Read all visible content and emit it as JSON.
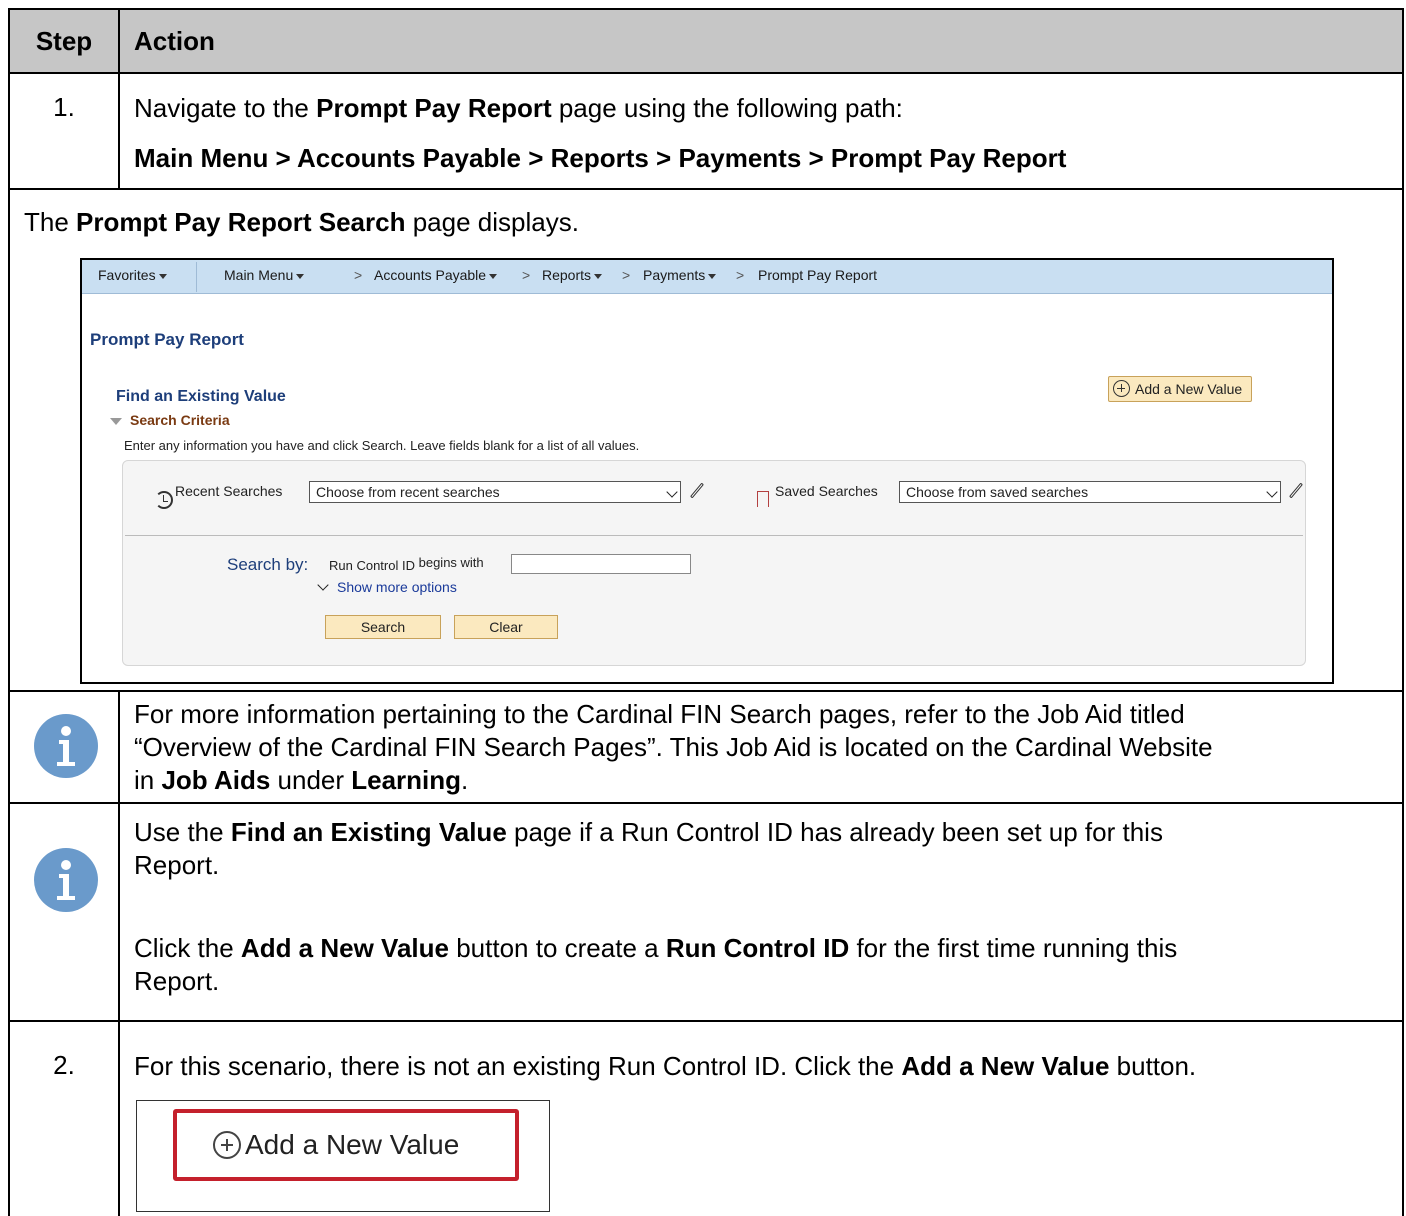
{
  "header": {
    "step": "Step",
    "action": "Action"
  },
  "step1": {
    "num": "1.",
    "line1_pre": "Navigate to the ",
    "line1_bold": "Prompt Pay Report",
    "line1_post": " page using the following path:",
    "path": "Main Menu > Accounts Payable > Reports > Payments > Prompt Pay Report"
  },
  "display": {
    "pre": "The ",
    "bold": "Prompt Pay Report Search",
    "post": " page displays."
  },
  "shot": {
    "nav": {
      "favorites": "Favorites",
      "main_menu": "Main Menu",
      "accounts_payable": "Accounts Payable",
      "reports": "Reports",
      "payments": "Payments",
      "prompt_pay": "Prompt Pay Report",
      "sep": ">"
    },
    "page_title": "Prompt Pay Report",
    "add_new": "Add a New Value",
    "find_title": "Find an Existing Value",
    "criteria": "Search Criteria",
    "instructions": "Enter any information you have and click Search. Leave fields blank for a list of all values.",
    "recent_label": "Recent Searches",
    "recent_value": "Choose from recent searches",
    "saved_label": "Saved Searches",
    "saved_value": "Choose from saved searches",
    "search_by": "Search by:",
    "field_label": "Run Control ID",
    "operator": "begins with",
    "field_value": "",
    "more_options": "Show more options",
    "search_btn": "Search",
    "clear_btn": "Clear"
  },
  "note1": {
    "line1": "For more information pertaining to the Cardinal FIN Search pages, refer to the Job Aid titled",
    "line2": "“Overview of the Cardinal FIN Search Pages”.  This Job Aid is located on the Cardinal Website",
    "line3_pre": "in ",
    "line3_b1": "Job Aids",
    "line3_mid": " under ",
    "line3_b2": "Learning",
    "line3_post": "."
  },
  "note2": {
    "p1_pre": "Use the ",
    "p1_bold": "Find an Existing Value",
    "p1_post": " page if a Run Control ID has already been set up for this",
    "p1_line2": "Report.",
    "p2_pre": "Click the ",
    "p2_b1": "Add a New Value",
    "p2_mid": " button to create a ",
    "p2_b2": "Run Control ID",
    "p2_post": " for the first time running this",
    "p2_line2": "Report."
  },
  "step2": {
    "num": "2.",
    "pre": "For this scenario, there is not an existing Run Control ID.  Click the ",
    "bold": "Add a New Value",
    "post": " button.",
    "button_label": "Add a New Value"
  }
}
